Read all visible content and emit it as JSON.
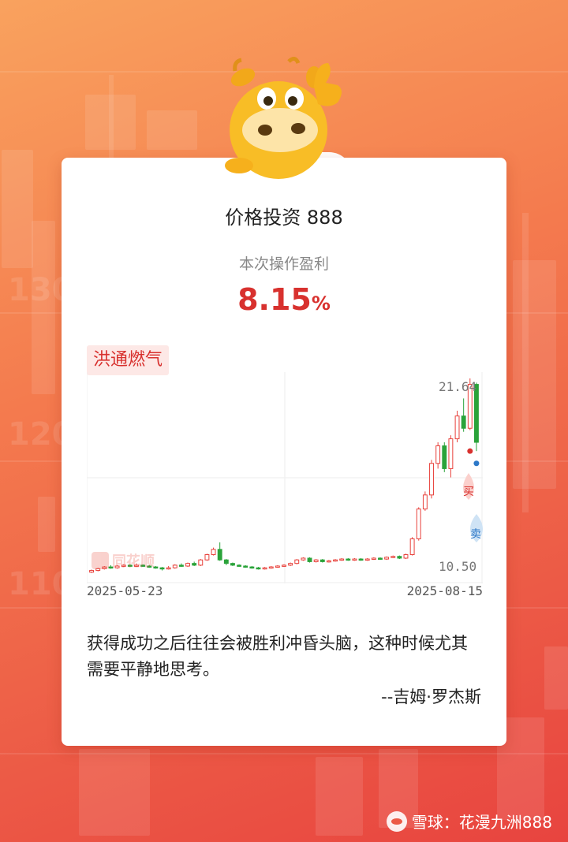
{
  "card": {
    "title": "价格投资 888",
    "subtitle": "本次操作盈利",
    "profit_value": "8.15",
    "profit_unit": "%",
    "stock_name": "洪通燃气",
    "quote": "获得成功之后往往会被胜利冲昏头脑，这种时候尤其需要平静地思考。",
    "author": "--吉姆·罗杰斯"
  },
  "chart_data": {
    "type": "candlestick",
    "x_start_label": "2025-05-23",
    "x_end_label": "2025-08-15",
    "y_max_label": "21.64",
    "y_min_label": "10.50",
    "ylim": [
      10.5,
      21.64
    ],
    "buy_marker": "买",
    "sell_marker": "卖",
    "candles": [
      [
        10.6,
        10.7,
        10.55,
        10.75,
        "up"
      ],
      [
        10.7,
        10.8,
        10.65,
        10.85,
        "up"
      ],
      [
        10.8,
        10.9,
        10.75,
        10.95,
        "up"
      ],
      [
        10.9,
        10.85,
        10.8,
        11.0,
        "up"
      ],
      [
        10.85,
        10.95,
        10.8,
        11.0,
        "up"
      ],
      [
        10.95,
        11.0,
        10.9,
        11.05,
        "up"
      ],
      [
        11.0,
        10.95,
        10.9,
        11.05,
        "up"
      ],
      [
        10.95,
        11.0,
        10.9,
        11.1,
        "up"
      ],
      [
        11.0,
        10.95,
        10.9,
        11.05,
        "down"
      ],
      [
        10.95,
        10.9,
        10.85,
        11.0,
        "up"
      ],
      [
        10.9,
        10.85,
        10.8,
        10.95,
        "up"
      ],
      [
        10.85,
        10.8,
        10.7,
        10.9,
        "up"
      ],
      [
        10.8,
        10.85,
        10.75,
        10.95,
        "up"
      ],
      [
        10.85,
        11.0,
        10.8,
        11.05,
        "up"
      ],
      [
        11.0,
        10.95,
        10.9,
        11.1,
        "down"
      ],
      [
        10.95,
        11.1,
        10.9,
        11.15,
        "up"
      ],
      [
        11.1,
        11.0,
        10.95,
        11.2,
        "down"
      ],
      [
        11.0,
        11.3,
        10.95,
        11.35,
        "up"
      ],
      [
        11.3,
        11.6,
        11.25,
        11.65,
        "up"
      ],
      [
        11.6,
        11.9,
        11.55,
        12.0,
        "up"
      ],
      [
        11.9,
        11.3,
        11.25,
        12.3,
        "down"
      ],
      [
        11.3,
        11.1,
        11.0,
        11.35,
        "down"
      ],
      [
        11.1,
        11.0,
        10.95,
        11.15,
        "down"
      ],
      [
        11.0,
        10.95,
        10.9,
        11.05,
        "up"
      ],
      [
        10.95,
        10.9,
        10.85,
        11.0,
        "up"
      ],
      [
        10.9,
        10.85,
        10.8,
        10.95,
        "up"
      ],
      [
        10.85,
        10.8,
        10.75,
        10.9,
        "up"
      ],
      [
        10.8,
        10.85,
        10.75,
        10.9,
        "up"
      ],
      [
        10.85,
        10.9,
        10.8,
        10.95,
        "up"
      ],
      [
        10.9,
        10.95,
        10.85,
        11.0,
        "up"
      ],
      [
        10.95,
        11.0,
        10.9,
        11.05,
        "up"
      ],
      [
        11.0,
        11.1,
        10.95,
        11.15,
        "up"
      ],
      [
        11.1,
        11.3,
        11.05,
        11.35,
        "up"
      ],
      [
        11.3,
        11.4,
        11.25,
        11.45,
        "up"
      ],
      [
        11.4,
        11.2,
        11.15,
        11.45,
        "down"
      ],
      [
        11.2,
        11.3,
        11.15,
        11.35,
        "down"
      ],
      [
        11.3,
        11.2,
        11.15,
        11.35,
        "down"
      ],
      [
        11.2,
        11.25,
        11.15,
        11.3,
        "up"
      ],
      [
        11.25,
        11.3,
        11.2,
        11.35,
        "up"
      ],
      [
        11.3,
        11.35,
        11.25,
        11.4,
        "up"
      ],
      [
        11.35,
        11.3,
        11.25,
        11.4,
        "up"
      ],
      [
        11.3,
        11.35,
        11.25,
        11.4,
        "up"
      ],
      [
        11.35,
        11.3,
        11.25,
        11.4,
        "up"
      ],
      [
        11.3,
        11.35,
        11.25,
        11.4,
        "up"
      ],
      [
        11.35,
        11.4,
        11.3,
        11.45,
        "up"
      ],
      [
        11.4,
        11.35,
        11.3,
        11.45,
        "up"
      ],
      [
        11.35,
        11.45,
        11.3,
        11.5,
        "up"
      ],
      [
        11.45,
        11.5,
        11.4,
        11.55,
        "up"
      ],
      [
        11.5,
        11.4,
        11.35,
        11.55,
        "down"
      ],
      [
        11.4,
        11.6,
        11.35,
        11.65,
        "up"
      ],
      [
        11.6,
        12.5,
        11.55,
        12.6,
        "up"
      ],
      [
        12.5,
        14.2,
        12.4,
        14.3,
        "up"
      ],
      [
        14.2,
        15.0,
        14.1,
        15.2,
        "up"
      ],
      [
        15.0,
        16.8,
        14.8,
        17.0,
        "up"
      ],
      [
        16.8,
        17.8,
        16.5,
        18.0,
        "up"
      ],
      [
        17.8,
        16.5,
        16.3,
        18.0,
        "down"
      ],
      [
        16.5,
        18.2,
        16.0,
        18.4,
        "up"
      ],
      [
        18.2,
        19.5,
        18.0,
        19.8,
        "up"
      ],
      [
        19.5,
        18.8,
        18.6,
        20.5,
        "down"
      ],
      [
        18.8,
        21.3,
        18.7,
        21.64,
        "down"
      ],
      [
        21.3,
        18.0,
        17.5,
        21.4,
        "up"
      ]
    ]
  }
}
